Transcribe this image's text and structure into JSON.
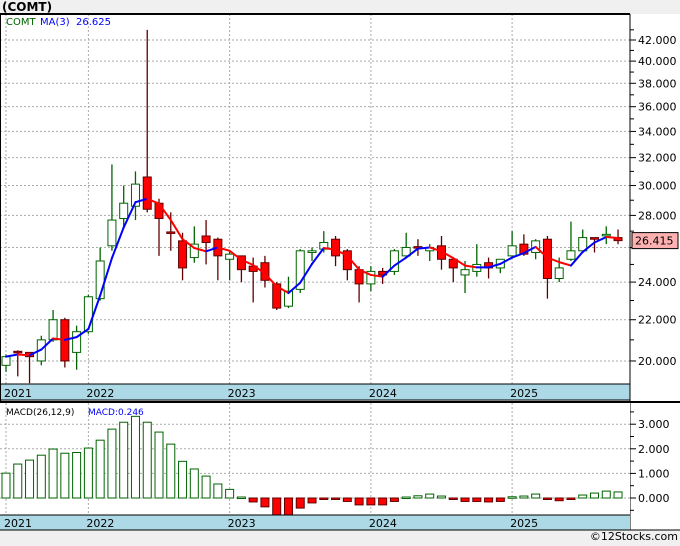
{
  "header": {
    "title": "(COMT)",
    "symbol": "COMT",
    "ma_label": "MA(3)",
    "ma_value": "26.625"
  },
  "macd_legend": {
    "label": "MACD(26,12,9)",
    "value_text": "MACD:0.246"
  },
  "copyright": "©12Stocks.com",
  "colors": {
    "up": "#006400",
    "down": "#ff0000",
    "down_border": "#600000",
    "ma_up": "#0000ff",
    "ma_down": "#ff0000",
    "date_strip": "#add8e6",
    "last_price_bg": "#ffb0b0"
  },
  "chart_data": [
    {
      "type": "candlestick",
      "title": "COMT",
      "scale": "log",
      "ylim": [
        18.5,
        43.5
      ],
      "y_ticks": [
        "20.000",
        "22.000",
        "24.000",
        "26.000",
        "28.000",
        "30.000",
        "32.000",
        "34.000",
        "36.000",
        "38.000",
        "40.000",
        "42.000"
      ],
      "y_tick_values": [
        20,
        22,
        24,
        26,
        28,
        30,
        32,
        34,
        36,
        38,
        40,
        42
      ],
      "labeled_y_ticks": [
        "20.000",
        "22.000",
        "24.000",
        "28.000",
        "30.000",
        "32.000",
        "34.000",
        "36.000",
        "38.000",
        "40.000",
        "42.000"
      ],
      "x_ticks": [
        {
          "label": "2021",
          "index": 0
        },
        {
          "label": "2022",
          "index": 7
        },
        {
          "label": "2023",
          "index": 19
        },
        {
          "label": "2024",
          "index": 31
        },
        {
          "label": "2025",
          "index": 43
        }
      ],
      "last_price": "26.415",
      "ma_period": 3,
      "ohlc": [
        [
          19.8,
          20.3,
          19.5,
          20.2
        ],
        [
          20.45,
          20.5,
          19.3,
          20.4
        ],
        [
          20.4,
          20.4,
          19.0,
          20.2
        ],
        [
          20.0,
          21.2,
          19.8,
          21.0
        ],
        [
          21.0,
          22.5,
          20.9,
          22.0
        ],
        [
          22.0,
          22.1,
          19.7,
          20.0
        ],
        [
          20.4,
          21.7,
          19.6,
          21.4
        ],
        [
          21.4,
          23.3,
          21.3,
          23.2
        ],
        [
          23.1,
          26.0,
          23.0,
          25.2
        ],
        [
          26.1,
          31.5,
          25.8,
          27.7
        ],
        [
          27.8,
          30.0,
          27.2,
          28.8
        ],
        [
          28.6,
          31.0,
          27.7,
          30.1
        ],
        [
          30.6,
          43.0,
          28.2,
          28.4
        ],
        [
          28.8,
          29.1,
          25.5,
          27.8
        ],
        [
          26.95,
          28.2,
          25.8,
          26.9
        ],
        [
          26.4,
          26.9,
          24.1,
          24.8
        ],
        [
          25.4,
          27.3,
          25.1,
          26.2
        ],
        [
          26.7,
          27.7,
          25.0,
          26.3
        ],
        [
          26.5,
          26.6,
          24.1,
          25.5
        ],
        [
          25.3,
          25.8,
          24.1,
          25.6
        ],
        [
          25.5,
          25.5,
          24.0,
          24.7
        ],
        [
          24.9,
          25.4,
          22.9,
          24.6
        ],
        [
          25.1,
          25.5,
          23.7,
          24.1
        ],
        [
          23.9,
          24.0,
          22.5,
          22.6
        ],
        [
          22.7,
          24.3,
          22.6,
          23.5
        ],
        [
          23.6,
          25.9,
          23.4,
          25.8
        ],
        [
          25.7,
          26.0,
          25.2,
          25.8
        ],
        [
          25.9,
          27.0,
          25.7,
          26.3
        ],
        [
          26.5,
          26.7,
          24.9,
          25.5
        ],
        [
          25.8,
          25.9,
          24.1,
          24.7
        ],
        [
          24.7,
          24.9,
          22.9,
          23.9
        ],
        [
          23.9,
          24.9,
          23.5,
          24.6
        ],
        [
          24.6,
          24.8,
          23.9,
          24.4
        ],
        [
          24.6,
          25.9,
          24.4,
          25.8
        ],
        [
          25.5,
          26.9,
          25.4,
          26.0
        ],
        [
          26.05,
          26.5,
          25.5,
          26.0
        ],
        [
          25.8,
          26.2,
          25.2,
          26.0
        ],
        [
          26.1,
          26.7,
          24.7,
          25.3
        ],
        [
          25.3,
          25.4,
          24.0,
          24.8
        ],
        [
          24.4,
          25.2,
          23.4,
          24.7
        ],
        [
          24.6,
          26.2,
          24.3,
          25.0
        ],
        [
          25.1,
          25.4,
          24.2,
          24.8
        ],
        [
          24.8,
          25.3,
          24.5,
          25.3
        ],
        [
          25.5,
          27.0,
          25.4,
          26.1
        ],
        [
          26.2,
          26.8,
          25.5,
          25.6
        ],
        [
          25.7,
          26.5,
          25.3,
          26.4
        ],
        [
          26.5,
          26.7,
          23.1,
          24.2
        ],
        [
          24.2,
          25.4,
          24.0,
          24.8
        ],
        [
          25.3,
          27.6,
          25.2,
          25.8
        ],
        [
          25.8,
          27.1,
          25.7,
          26.6
        ],
        [
          26.6,
          26.6,
          25.7,
          26.5
        ],
        [
          26.75,
          27.3,
          26.2,
          26.8
        ],
        [
          26.6,
          27.1,
          26.2,
          26.415
        ]
      ]
    },
    {
      "type": "bar",
      "title": "MACD(26,12,9)",
      "ylim": [
        -0.7,
        3.8
      ],
      "y_ticks": [
        "0.000",
        "1.000",
        "2.000",
        "3.000"
      ],
      "y_tick_values": [
        0,
        1,
        2,
        3
      ],
      "x_ticks": [
        {
          "label": "2021",
          "index": 0
        },
        {
          "label": "2022",
          "index": 7
        },
        {
          "label": "2023",
          "index": 19
        },
        {
          "label": "2024",
          "index": 31
        },
        {
          "label": "2025",
          "index": 43
        }
      ],
      "values": [
        1.01,
        1.38,
        1.54,
        1.74,
        1.99,
        1.82,
        1.85,
        2.03,
        2.35,
        2.8,
        3.08,
        3.32,
        3.08,
        2.68,
        2.19,
        1.49,
        1.18,
        0.89,
        0.57,
        0.35,
        0.04,
        -0.16,
        -0.36,
        -0.8,
        -0.8,
        -0.41,
        -0.2,
        -0.01,
        -0.01,
        -0.14,
        -0.28,
        -0.28,
        -0.28,
        -0.14,
        0.04,
        0.09,
        0.16,
        0.08,
        -0.03,
        -0.14,
        -0.14,
        -0.16,
        -0.14,
        0.05,
        0.08,
        0.16,
        -0.03,
        -0.11,
        -0.03,
        0.12,
        0.2,
        0.28,
        0.246
      ]
    }
  ]
}
